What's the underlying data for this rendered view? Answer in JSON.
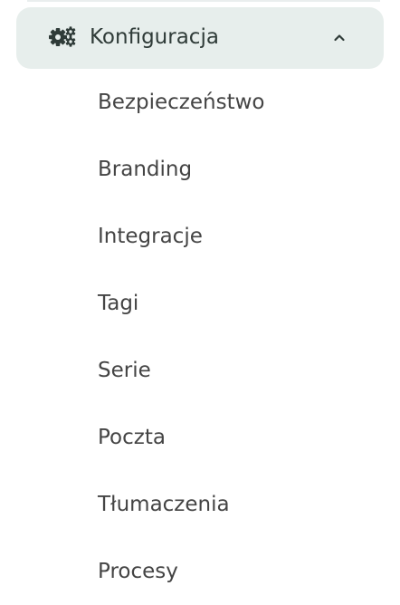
{
  "sidebar": {
    "group": {
      "label": "Konfiguracja",
      "icon": "gears-icon",
      "expanded": true,
      "toggle_icon": "chevron-up-icon"
    },
    "items": [
      {
        "label": "Bezpieczeństwo"
      },
      {
        "label": "Branding"
      },
      {
        "label": "Integracje"
      },
      {
        "label": "Tagi"
      },
      {
        "label": "Serie"
      },
      {
        "label": "Poczta"
      },
      {
        "label": "Tłumaczenia"
      },
      {
        "label": "Procesy"
      }
    ]
  },
  "colors": {
    "header_background": "#e7eeec",
    "icon": "#2f3b38",
    "text": "#444444"
  }
}
